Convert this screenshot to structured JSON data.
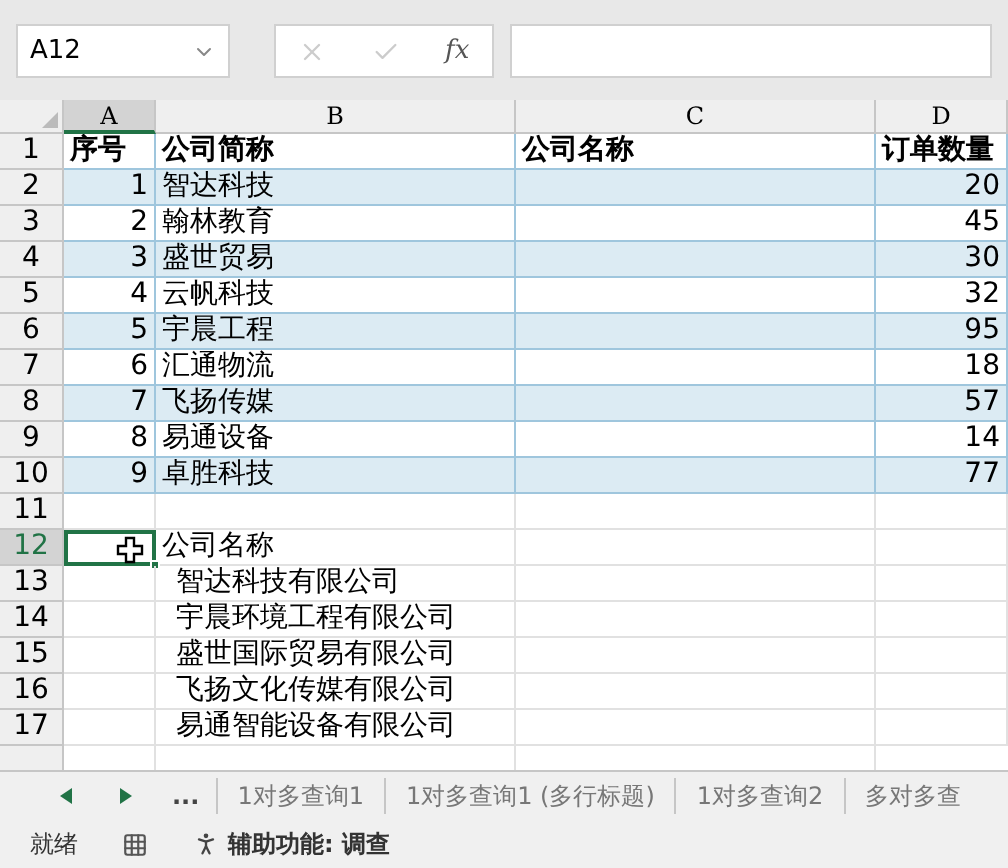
{
  "name_box": {
    "value": "A12"
  },
  "formula_bar": {
    "function_label": "fx"
  },
  "columns": [
    {
      "label": "A",
      "selected": true
    },
    {
      "label": "B",
      "selected": false
    },
    {
      "label": "C",
      "selected": false
    },
    {
      "label": "D",
      "selected": false
    }
  ],
  "header_row": {
    "number": "1",
    "cells": [
      "序号",
      "公司简称",
      "公司名称",
      "订单数量"
    ]
  },
  "data_rows": [
    {
      "number": "2",
      "seq": "1",
      "short_name": "智达科技",
      "order_count": "20"
    },
    {
      "number": "3",
      "seq": "2",
      "short_name": "翰林教育",
      "order_count": "45"
    },
    {
      "number": "4",
      "seq": "3",
      "short_name": "盛世贸易",
      "order_count": "30"
    },
    {
      "number": "5",
      "seq": "4",
      "short_name": "云帆科技",
      "order_count": "32"
    },
    {
      "number": "6",
      "seq": "5",
      "short_name": "宇晨工程",
      "order_count": "95"
    },
    {
      "number": "7",
      "seq": "6",
      "short_name": "汇通物流",
      "order_count": "18"
    },
    {
      "number": "8",
      "seq": "7",
      "short_name": "飞扬传媒",
      "order_count": "57"
    },
    {
      "number": "9",
      "seq": "8",
      "short_name": "易通设备",
      "order_count": "14"
    },
    {
      "number": "10",
      "seq": "9",
      "short_name": "卓胜科技",
      "order_count": "77"
    }
  ],
  "lower_rows": [
    {
      "number": "11",
      "selected": false
    },
    {
      "number": "12",
      "selected": true,
      "text": "公司名称",
      "kind": "heading"
    },
    {
      "number": "13",
      "selected": false,
      "text": "智达科技有限公司",
      "kind": "item"
    },
    {
      "number": "14",
      "selected": false,
      "text": "宇晨环境工程有限公司",
      "kind": "item"
    },
    {
      "number": "15",
      "selected": false,
      "text": "盛世国际贸易有限公司",
      "kind": "item"
    },
    {
      "number": "16",
      "selected": false,
      "text": "飞扬文化传媒有限公司",
      "kind": "item"
    },
    {
      "number": "17",
      "selected": false,
      "text": "易通智能设备有限公司",
      "kind": "item"
    }
  ],
  "sheet_tabs": {
    "more": "...",
    "tabs": [
      {
        "label": "1对多查询1",
        "selected": false
      },
      {
        "label": "1对多查询1 (多行标题)",
        "selected": false
      },
      {
        "label": "1对多查询2",
        "selected": false
      },
      {
        "label": "多对多查",
        "selected": false
      }
    ]
  },
  "status_bar": {
    "status": "就绪",
    "accessibility": "辅助功能: 调查"
  }
}
